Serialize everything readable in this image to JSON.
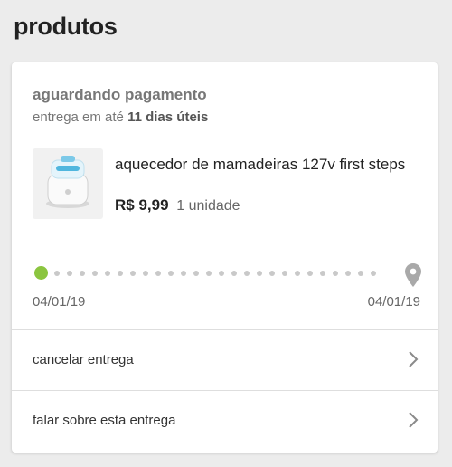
{
  "page": {
    "title": "produtos"
  },
  "order": {
    "status": "aguardando pagamento",
    "delivery_prefix": "entrega em até",
    "delivery_days": "11 dias úteis",
    "product": {
      "name": "aquecedor de mamadeiras 127v first steps",
      "price": "R$ 9,99",
      "quantity": "1 unidade",
      "image_icon": "baby-bottle-warmer-image"
    },
    "progress": {
      "start_date": "04/01/19",
      "end_date": "04/01/19",
      "completed_color": "#8bc53f",
      "pending_color": "#c9c9c9",
      "destination_icon": "location-pin-icon"
    }
  },
  "actions": [
    {
      "label": "cancelar entrega",
      "icon": "chevron-right-icon"
    },
    {
      "label": "falar sobre esta entrega",
      "icon": "chevron-right-icon"
    }
  ]
}
